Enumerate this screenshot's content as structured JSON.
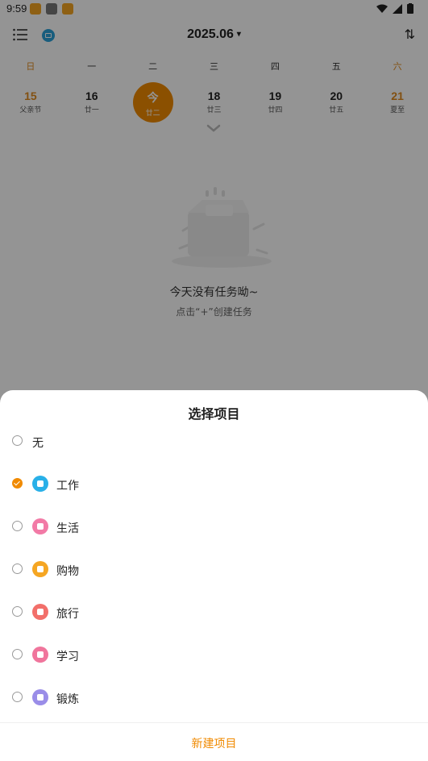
{
  "status": {
    "time": "9:59"
  },
  "header": {
    "month": "2025.06",
    "caret": "▾",
    "sort_icon": "⇅"
  },
  "week": {
    "labels": [
      "日",
      "一",
      "二",
      "三",
      "四",
      "五",
      "六"
    ],
    "days": [
      {
        "num": "15",
        "sub": "父亲节"
      },
      {
        "num": "16",
        "sub": "廿一"
      },
      {
        "num": "今",
        "sub": "廿二"
      },
      {
        "num": "18",
        "sub": "廿三"
      },
      {
        "num": "19",
        "sub": "廿四"
      },
      {
        "num": "20",
        "sub": "廿五"
      },
      {
        "num": "21",
        "sub": "夏至"
      }
    ]
  },
  "empty": {
    "title": "今天没有任务呦~",
    "subtitle": "点击“+”创建任务"
  },
  "sheet": {
    "title": "选择项目",
    "options": [
      {
        "label": "无",
        "icon": "none",
        "color": "",
        "checked": false
      },
      {
        "label": "工作",
        "icon": "briefcase-icon",
        "color": "#29b0e8",
        "checked": true
      },
      {
        "label": "生活",
        "icon": "cup-icon",
        "color": "#f27aa6",
        "checked": false
      },
      {
        "label": "购物",
        "icon": "basket-icon",
        "color": "#f5a623",
        "checked": false
      },
      {
        "label": "旅行",
        "icon": "plane-icon",
        "color": "#f26f6a",
        "checked": false
      },
      {
        "label": "学习",
        "icon": "book-icon",
        "color": "#f0759c",
        "checked": false
      },
      {
        "label": "锻炼",
        "icon": "dumbbell-icon",
        "color": "#9a8de8",
        "checked": false
      }
    ],
    "new_button": "新建项目"
  },
  "colors": {
    "accent": "#f08a00"
  }
}
